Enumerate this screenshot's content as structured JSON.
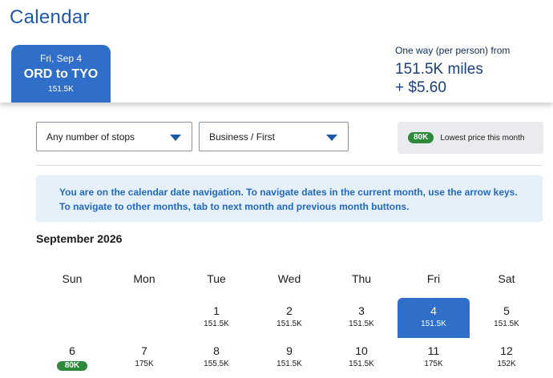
{
  "header": {
    "title": "Calendar"
  },
  "selected_date": {
    "date": "Fri, Sep 4",
    "route": "ORD to TYO",
    "price": "151.5K"
  },
  "fare": {
    "label": "One way (per person) from",
    "miles": "151.5K miles",
    "cash": "+ $5.60"
  },
  "filters": {
    "stops": "Any number of stops",
    "cabin": "Business / First"
  },
  "legend": {
    "badge": "80K",
    "text": "Lowest price this month"
  },
  "notice": "You are on the calendar date navigation. To navigate dates in the current month, use the arrow keys. To navigate to other months, tab to next month and previous month buttons.",
  "calendar": {
    "month": "September 2026",
    "weekdays": [
      "Sun",
      "Mon",
      "Tue",
      "Wed",
      "Thu",
      "Fri",
      "Sat"
    ],
    "week1": [
      {
        "day": "1",
        "price": "151.5K"
      },
      {
        "day": "2",
        "price": "151.5K"
      },
      {
        "day": "3",
        "price": "151.5K"
      },
      {
        "day": "4",
        "price": "151.5K"
      },
      {
        "day": "5",
        "price": "151.5K"
      }
    ],
    "week2": [
      {
        "day": "6",
        "price": "80K"
      },
      {
        "day": "7",
        "price": "175K"
      },
      {
        "day": "8",
        "price": "155.5K"
      },
      {
        "day": "9",
        "price": "151.5K"
      },
      {
        "day": "10",
        "price": "151.5K"
      },
      {
        "day": "11",
        "price": "175K"
      },
      {
        "day": "12",
        "price": "152K"
      }
    ]
  },
  "colors": {
    "primary": "#2f6ec9",
    "lowest_price": "#2c8a3a",
    "notice_bg": "#e6f0fb"
  }
}
